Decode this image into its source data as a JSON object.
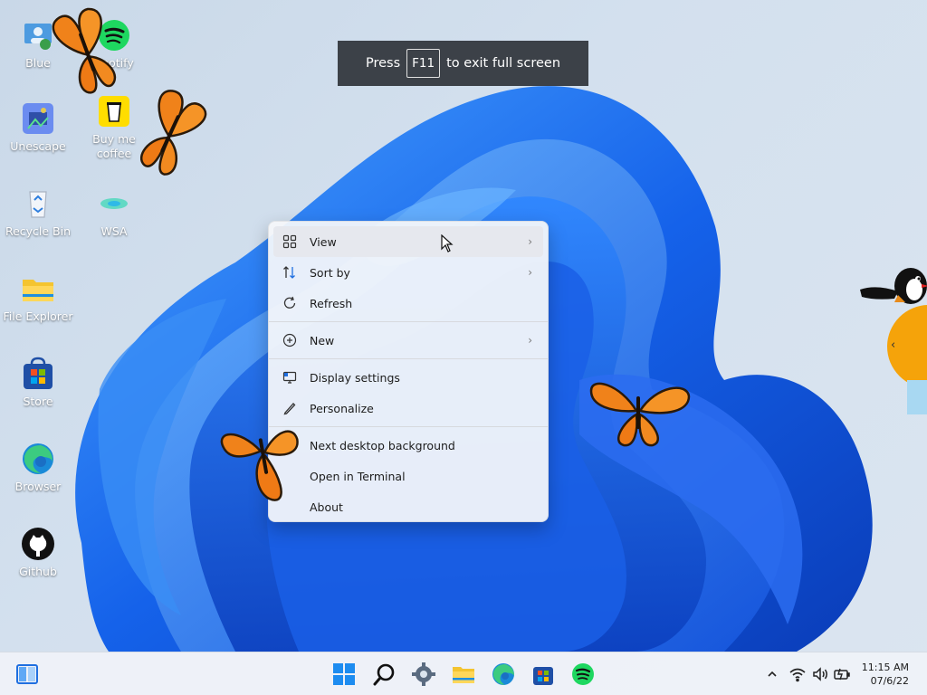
{
  "desktop": {
    "icons": [
      {
        "label": "Blue",
        "icon": "user-icon"
      },
      {
        "label": "Spotify",
        "icon": "spotify-icon"
      },
      {
        "label": "Unescape",
        "icon": "unescape-icon"
      },
      {
        "label": "Buy me coffee",
        "icon": "coffee-cup-icon"
      },
      {
        "label": "Recycle Bin",
        "icon": "recycle-bin-icon"
      },
      {
        "label": "WSA",
        "icon": "wsa-icon"
      },
      {
        "label": "File Explorer",
        "icon": "folder-icon"
      },
      {
        "label": "Store",
        "icon": "store-icon"
      },
      {
        "label": "Browser",
        "icon": "edge-icon"
      },
      {
        "label": "Github",
        "icon": "github-icon"
      }
    ]
  },
  "banner": {
    "prefix": "Press",
    "key": "F11",
    "suffix": "to exit full screen"
  },
  "context_menu": {
    "items": [
      {
        "label": "View",
        "icon": "grid-icon",
        "submenu": true
      },
      {
        "label": "Sort by",
        "icon": "sort-icon",
        "submenu": true
      },
      {
        "label": "Refresh",
        "icon": "refresh-icon",
        "submenu": false
      },
      {
        "label": "New",
        "icon": "plus-circle-icon",
        "submenu": true
      },
      {
        "label": "Display settings",
        "icon": "display-icon",
        "submenu": false
      },
      {
        "label": "Personalize",
        "icon": "pen-icon",
        "submenu": false
      },
      {
        "label": "Next desktop background",
        "icon": "",
        "submenu": false
      },
      {
        "label": "Open in Terminal",
        "icon": "",
        "submenu": false
      },
      {
        "label": "About",
        "icon": "",
        "submenu": false
      }
    ]
  },
  "taskbar": {
    "clock": {
      "time": "11:15 AM",
      "date": "07/6/22"
    },
    "apps": [
      "start-icon",
      "search-icon",
      "settings-icon",
      "file-explorer-icon",
      "edge-icon",
      "store-icon",
      "spotify-icon"
    ],
    "tray": [
      "chevron-up-icon",
      "wifi-icon",
      "volume-icon",
      "battery-icon"
    ]
  },
  "colors": {
    "accent": "#1f6fe0",
    "wallpaper_blue": "#1560e8",
    "banner_bg": "#3c4148",
    "spotify_green": "#1ed760"
  }
}
